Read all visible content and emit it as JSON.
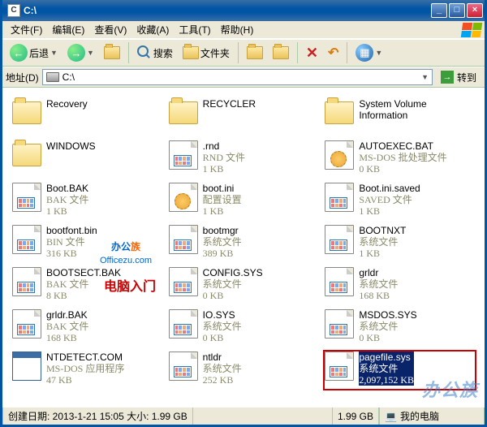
{
  "title": "C:\\",
  "menu": [
    "文件(F)",
    "编辑(E)",
    "查看(V)",
    "收藏(A)",
    "工具(T)",
    "帮助(H)"
  ],
  "toolbar": {
    "back": "后退",
    "search": "搜索",
    "folders": "文件夹"
  },
  "address": {
    "label": "地址(D)",
    "value": "C:\\",
    "go": "转到"
  },
  "files": [
    {
      "icon": "folder",
      "name": "Recovery"
    },
    {
      "icon": "folder",
      "name": "RECYCLER"
    },
    {
      "icon": "folder",
      "name": "System Volume\nInformation"
    },
    {
      "icon": "folder",
      "name": "WINDOWS"
    },
    {
      "icon": "page-mini",
      "name": ".rnd",
      "type": "RND 文件",
      "size": "1 KB"
    },
    {
      "icon": "page-gear",
      "name": "AUTOEXEC.BAT",
      "type": "MS-DOS 批处理文件",
      "size": "0 KB"
    },
    {
      "icon": "page-mini",
      "name": "Boot.BAK",
      "type": "BAK 文件",
      "size": "1 KB"
    },
    {
      "icon": "page-gear",
      "name": "boot.ini",
      "type": "配置设置",
      "size": "1 KB"
    },
    {
      "icon": "page-mini",
      "name": "Boot.ini.saved",
      "type": "SAVED 文件",
      "size": "1 KB"
    },
    {
      "icon": "page-mini",
      "name": "bootfont.bin",
      "type": "BIN 文件",
      "size": "316 KB"
    },
    {
      "icon": "page-mini",
      "name": "bootmgr",
      "type": "系统文件",
      "size": "389 KB"
    },
    {
      "icon": "page-mini",
      "name": "BOOTNXT",
      "type": "系统文件",
      "size": "1 KB"
    },
    {
      "icon": "page-mini",
      "name": "BOOTSECT.BAK",
      "type": "BAK 文件",
      "size": "8 KB"
    },
    {
      "icon": "page-mini",
      "name": "CONFIG.SYS",
      "type": "系统文件",
      "size": "0 KB"
    },
    {
      "icon": "page-mini",
      "name": "grldr",
      "type": "系统文件",
      "size": "168 KB"
    },
    {
      "icon": "page-mini",
      "name": "grldr.BAK",
      "type": "BAK 文件",
      "size": "168 KB"
    },
    {
      "icon": "page-mini",
      "name": "IO.SYS",
      "type": "系统文件",
      "size": "0 KB"
    },
    {
      "icon": "page-mini",
      "name": "MSDOS.SYS",
      "type": "系统文件",
      "size": "0 KB"
    },
    {
      "icon": "appwin",
      "name": "NTDETECT.COM",
      "type": "MS-DOS 应用程序",
      "size": "47 KB"
    },
    {
      "icon": "page-mini",
      "name": "ntldr",
      "type": "系统文件",
      "size": "252 KB"
    },
    {
      "icon": "page-mini",
      "name": "pagefile.sys",
      "type": "系统文件",
      "size": "2,097,152 KB",
      "selected": true,
      "highlight": true
    }
  ],
  "status": {
    "left": "创建日期: 2013-1-21 15:05 大小: 1.99 GB",
    "mid": "1.99 GB",
    "right": "我的电脑"
  },
  "watermarks": {
    "bgz1": "办公",
    "bgz2": "族",
    "bgz_sub": "Officezu.com",
    "dnrm": "电脑入门",
    "bottom": "办公族"
  }
}
